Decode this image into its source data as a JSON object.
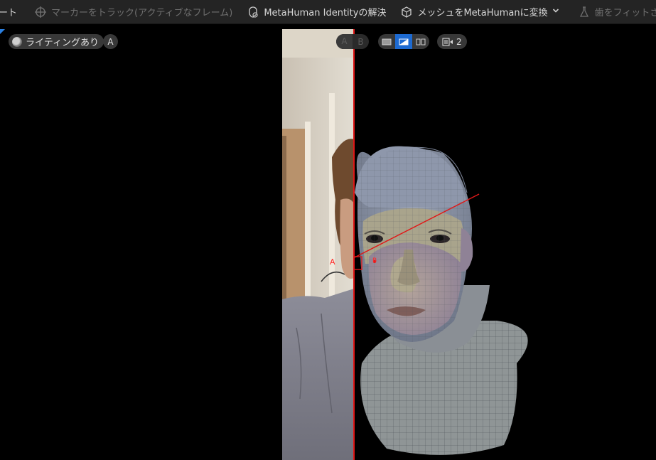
{
  "toolbar": {
    "partial_label": "ート",
    "track_markers_label": "マーカーをトラック(アクティブなフレーム)",
    "solve_identity_label": "MetaHuman Identityの解決",
    "mesh_to_metahuman_label": "メッシュをMetaHumanに変換",
    "fit_teeth_label": "歯をフィットさせる"
  },
  "viewport": {
    "lighting_label": "ライティングあり",
    "camera_a_label": "A",
    "ab_toggle": {
      "a": "A",
      "b": "B"
    },
    "view_count": "2",
    "marker_a": "A",
    "marker_b": "B"
  },
  "colors": {
    "accent": "#1d6ad1",
    "split_line": "#e01818",
    "toolbar_bg": "#242424"
  },
  "icons": {
    "track": "crosshair-icon",
    "solve": "head-identity-icon",
    "convert": "cube-convert-icon",
    "teeth": "flask-icon"
  }
}
